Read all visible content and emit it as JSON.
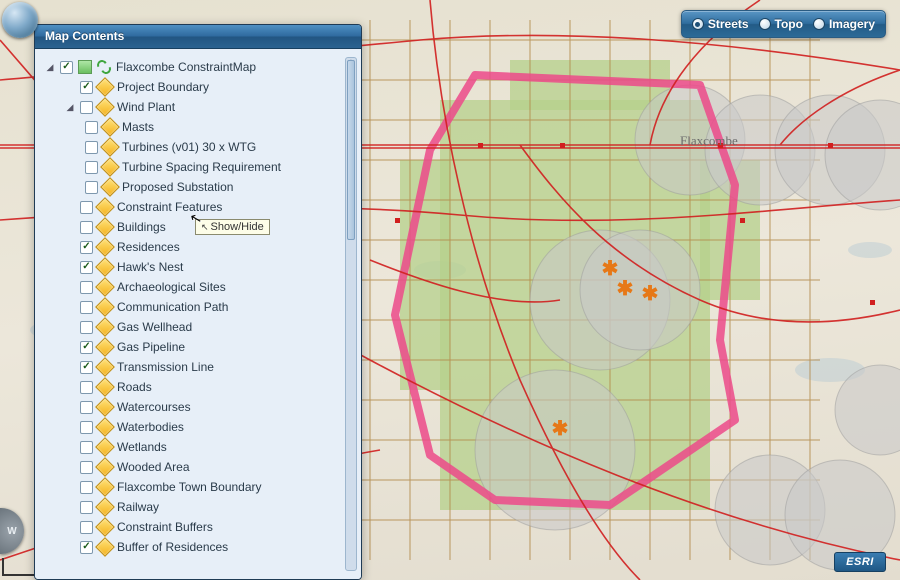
{
  "panel": {
    "title": "Map Contents"
  },
  "tooltip": {
    "text": "Show/Hide"
  },
  "basemap": {
    "options": [
      {
        "label": "Streets",
        "selected": true
      },
      {
        "label": "Topo",
        "selected": false
      },
      {
        "label": "Imagery",
        "selected": false
      }
    ]
  },
  "logo": "ESRI",
  "compass": "W",
  "map_label": "Flaxcombe",
  "tree": {
    "root": {
      "label": "Flaxcombe ConstraintMap",
      "checked": true,
      "expanded": true,
      "icons": [
        "map-thumb",
        "refresh-icon"
      ]
    },
    "layers": [
      {
        "label": "Project Boundary",
        "checked": true,
        "children": null
      },
      {
        "label": "Wind Plant",
        "checked": false,
        "expanded": true,
        "children": [
          {
            "label": "Masts",
            "checked": false
          },
          {
            "label": "Turbines (v01) 30 x WTG",
            "checked": false
          },
          {
            "label": "Turbine Spacing Requirement",
            "checked": false
          },
          {
            "label": "Proposed Substation",
            "checked": false
          }
        ]
      },
      {
        "label": "Constraint Features",
        "checked": false
      },
      {
        "label": "Buildings",
        "checked": false
      },
      {
        "label": "Residences",
        "checked": true
      },
      {
        "label": "Hawk's Nest",
        "checked": true
      },
      {
        "label": "Archaeological Sites",
        "checked": false
      },
      {
        "label": "Communication Path",
        "checked": false
      },
      {
        "label": "Gas Wellhead",
        "checked": false
      },
      {
        "label": "Gas Pipeline",
        "checked": true
      },
      {
        "label": "Transmission Line",
        "checked": true
      },
      {
        "label": "Roads",
        "checked": false
      },
      {
        "label": "Watercourses",
        "checked": false
      },
      {
        "label": "Waterbodies",
        "checked": false
      },
      {
        "label": "Wetlands",
        "checked": false
      },
      {
        "label": "Wooded Area",
        "checked": false
      },
      {
        "label": "Flaxcombe Town Boundary",
        "checked": false
      },
      {
        "label": "Railway",
        "checked": false
      },
      {
        "label": "Constraint Buffers",
        "checked": false
      },
      {
        "label": "Buffer of Residences",
        "checked": true
      }
    ]
  }
}
